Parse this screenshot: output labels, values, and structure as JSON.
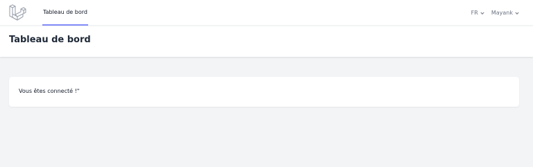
{
  "nav": {
    "logo_icon": "laravel-logo-icon",
    "dashboard_link": "Tableau de bord",
    "language": "FR",
    "user_name": "Mayank",
    "chevron_icon": "chevron-down-icon",
    "active_underline_color": "#818cf8"
  },
  "header": {
    "title": "Tableau de bord"
  },
  "main": {
    "message": "Vous êtes connecté !\""
  }
}
